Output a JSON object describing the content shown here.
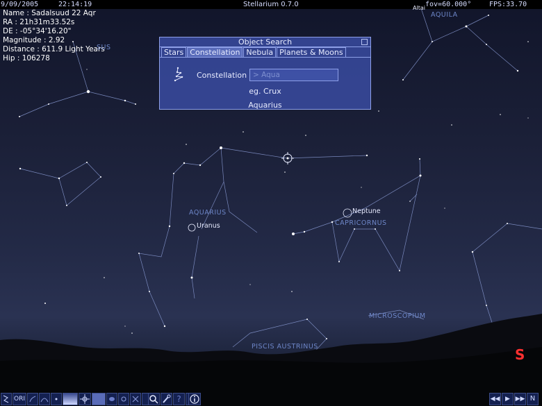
{
  "topbar": {
    "date": "9/09/2005",
    "time": "22:14:19",
    "title": "Stellarium 0.7.0",
    "fov": "fov=60.000°",
    "fps": "FPS:33.70"
  },
  "object_info": {
    "name": "Name : Sadalsuud 22 Aqr",
    "ra": "RA : 21h31m33.52s",
    "de": "DE : -05°34'16.20\"",
    "magnitude": "Magnitude : 2.92",
    "distance": "Distance : 611.9 Light Years",
    "hip": "Hip : 106278"
  },
  "sky_labels": {
    "aquila": "AQUILA",
    "pegasus_partial": "SUS",
    "altair_partial": "Altai",
    "aquarius": "AQUARIUS",
    "capricornus": "CAPRICORNUS",
    "microscopium": "MICROSCOPIUM",
    "piscis_austrinus": "PISCIS AUSTRINUS",
    "uranus": "Uranus",
    "neptune": "Neptune",
    "south": "S"
  },
  "search_dialog": {
    "title": "Object Search",
    "tabs": [
      "Stars",
      "Constellation",
      "Nebula",
      "Planets & Moons"
    ],
    "active_tab": "Constellation",
    "field_label": "Constellation",
    "input_value": "> Aqua",
    "hint": "eg. Crux",
    "result": "Aquarius"
  },
  "toolbar": {
    "ori_label": "ORI",
    "north_label": "N",
    "icons": [
      "constellation-lines-icon",
      "constellation-names-icon",
      "constellation-art-icon",
      "azimuth-grid-icon",
      "equatorial-grid-icon",
      "ground-icon",
      "cardinal-points-icon",
      "atmosphere-icon",
      "nebulae-icon",
      "search-icon",
      "config-icon",
      "help-icon",
      "info-icon",
      "rewind-icon",
      "play-icon",
      "fast-forward-icon"
    ]
  }
}
